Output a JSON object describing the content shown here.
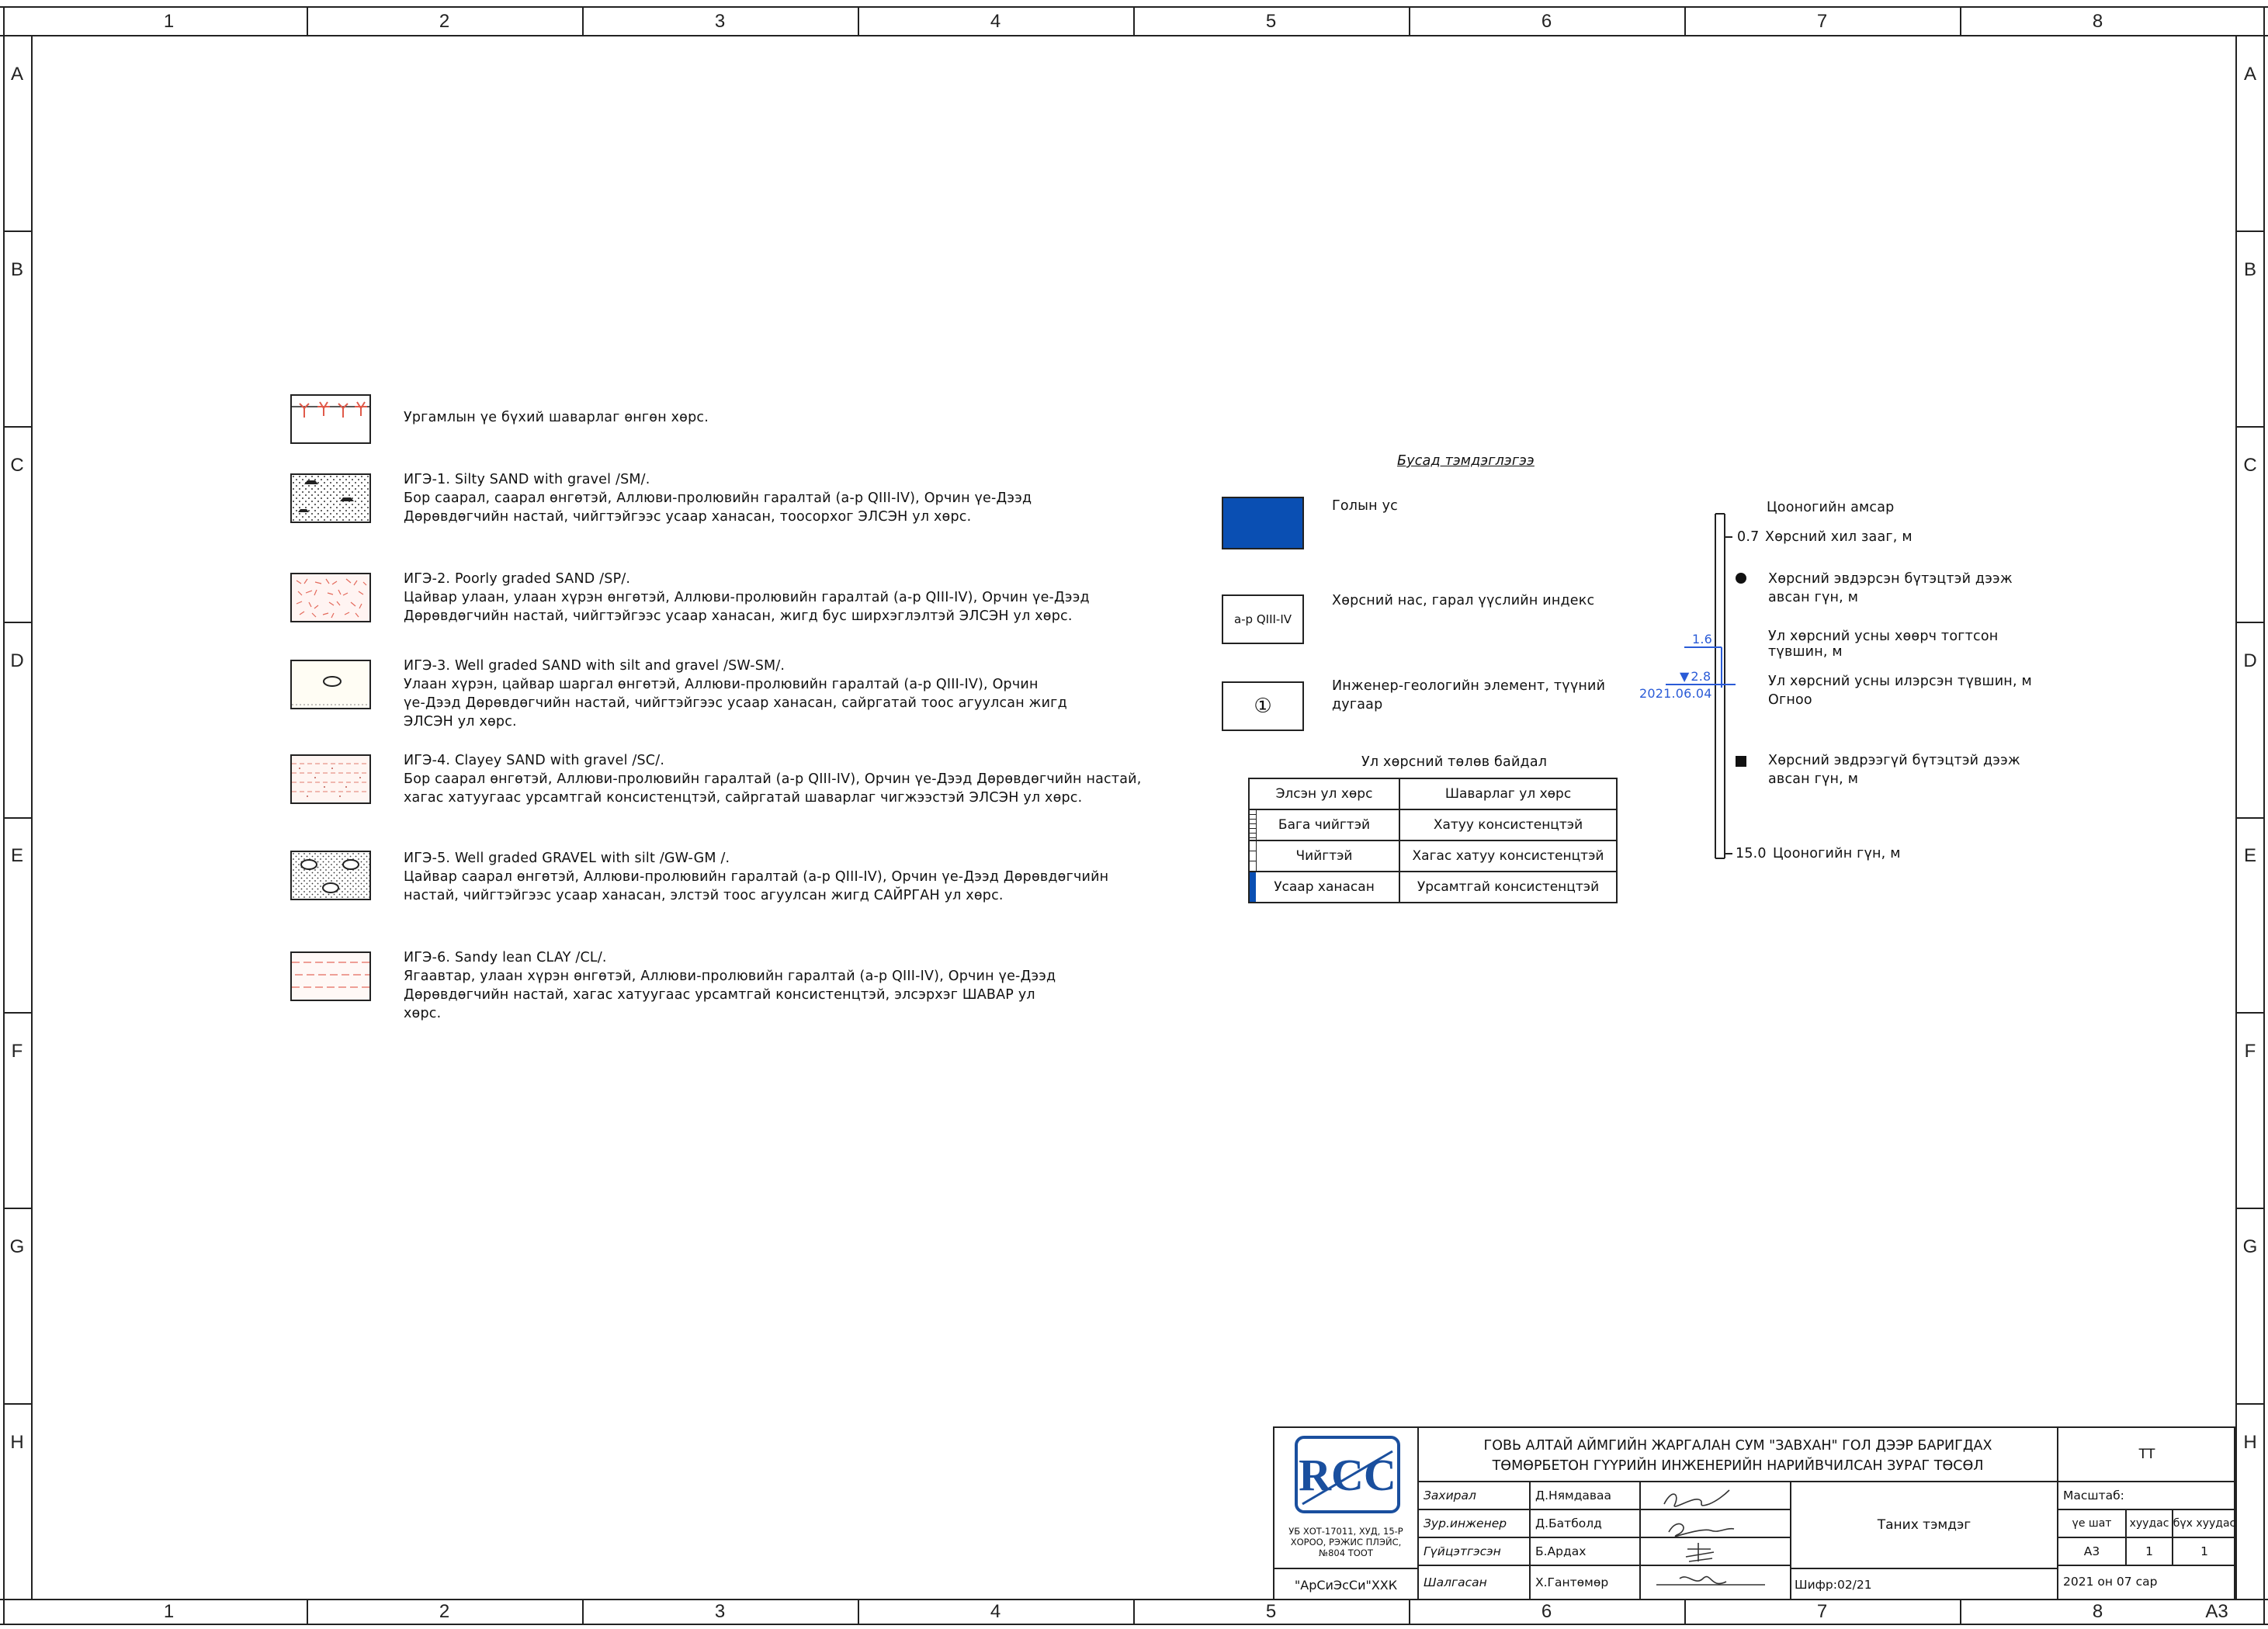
{
  "frame": {
    "col_labels": [
      "1",
      "2",
      "3",
      "4",
      "5",
      "6",
      "7",
      "8"
    ],
    "row_labels": [
      "A",
      "B",
      "C",
      "D",
      "E",
      "F",
      "G",
      "H"
    ],
    "sheet_size": "A3"
  },
  "legend": {
    "items": [
      {
        "id": "plant",
        "lines": [
          "Ургамлын үе бүхий шаварлаг өнгөн хөрс."
        ]
      },
      {
        "id": "ige1",
        "lines": [
          "ИГЭ-1. Silty SAND with gravel /SM/.",
          "Бор саарал, саарал өнгөтэй, Аллюви-пролювийн гаралтай (a-p QIII-IV), Орчин үе-Дээд",
          "Дөрөвдөгчийн настай, чийгтэйгээс усаар ханасан, тоосорхог ЭЛСЭН  ул  хөрс."
        ]
      },
      {
        "id": "ige2",
        "lines": [
          "ИГЭ-2. Poorly graded SAND  /SP/.",
          "Цайвар улаан, улаан хүрэн өнгөтэй, Аллюви-пролювийн гаралтай (a-p QIII-IV), Орчин үе-Дээд",
          "Дөрөвдөгчийн настай, чийгтэйгээс усаар ханасан, жигд бус ширхэглэлтэй ЭЛСЭН ул  хөрс."
        ]
      },
      {
        "id": "ige3",
        "lines": [
          "ИГЭ-3. Well graded SAND with silt and gravel  /SW-SM/.",
          "Улаан хүрэн, цайвар шаргал өнгөтэй, Аллюви-пролювийн гаралтай (a-p QIII-IV), Орчин",
          "үе-Дээд Дөрөвдөгчийн настай, чийгтэйгээс усаар ханасан, сайргатай тоос агуулсан жигд",
          "ЭЛСЭН ул  хөрс."
        ]
      },
      {
        "id": "ige4",
        "lines": [
          "ИГЭ-4. Clayey SAND with gravel /SC/.",
          "Бор саарал өнгөтэй, Аллюви-пролювийн гаралтай (a-p QIII-IV), Орчин үе-Дээд Дөрөвдөгчийн настай,",
          "хагас хатуугаас урсамтгай консистенцтэй, сайргатай шаварлаг чигжээстэй ЭЛСЭН ул  хөрс."
        ]
      },
      {
        "id": "ige5",
        "lines": [
          "ИГЭ-5. Well graded GRAVEL with silt /GW-GM /.",
          "Цайвар саарал өнгөтэй, Аллюви-пролювийн гаралтай (a-p QIII-IV), Орчин үе-Дээд Дөрөвдөгчийн",
          "настай, чийгтэйгээс усаар ханасан, элстэй тоос агуулсан жигд САЙРГАН ул  хөрс."
        ]
      },
      {
        "id": "ige6",
        "lines": [
          "ИГЭ-6. Sandy lean CLAY /CL/.",
          "Ягаавтар, улаан  хүрэн өнгөтэй, Аллюви-пролювийн гаралтай (a-p QIII-IV), Орчин үе-Дээд",
          "Дөрөвдөгчийн настай, хагас хатуугаас урсамтгай консистенцтэй, элсэрхэг ШАВАР ул",
          "хөрс."
        ]
      }
    ]
  },
  "other_symbols": {
    "title": "Бусад тэмдэглэгээ",
    "river": "Голын ус",
    "age_index_box": "a-p QIII-IV",
    "age_index": "Хөрсний нас, гарал үүслийн индекс",
    "element_number_box": "①",
    "element_number": [
      "Инженер-геологийн элемент, түүний",
      "дугаар"
    ],
    "soil_state_title": "Ул хөрсний төлөв байдал",
    "soil_state_table": {
      "headers": [
        "Элсэн ул хөрс",
        "Шаварлаг ул хөрс"
      ],
      "rows": [
        [
          "Бага чийгтэй",
          "Хатуу консистенцтэй"
        ],
        [
          "Чийгтэй",
          "Хагас хатуу консистенцтэй"
        ],
        [
          "Усаар ханасан",
          "Урсамтгай консистенцтэй"
        ]
      ]
    }
  },
  "borehole": {
    "collar": "Цооногийн амсар",
    "top_value": "0.7",
    "top_label": "Хөрсний хил зааг, м",
    "disturbed_sample": [
      "Хөрсний эвдэрсэн бүтэцтэй дээж",
      "авсан гүн, м"
    ],
    "water_stable_value": "1.6",
    "water_stable": [
      "Ул хөрсний усны хөөрч тогтсон",
      "түвшин, м"
    ],
    "water_found_value": "2.8",
    "water_date": "2021.06.04",
    "water_found": [
      "Ул хөрсний усны илэрсэн түвшин, м",
      "Огноо"
    ],
    "undisturbed_sample": [
      "Хөрсний эвдрээгүй бүтэцтэй дээж",
      "авсан гүн, м"
    ],
    "bottom_value": "15.0",
    "bottom_label": "Цооногийн гүн, м",
    "accent_color": "#2a5bd7"
  },
  "title_block": {
    "project_title": [
      "ГОВЬ АЛТАЙ АЙМГИЙН ЖАРГАЛАН СУМ \"ЗАВХАН\" ГОЛ ДЭЭР БАРИГДАХ",
      "ТӨМӨРБЕТОН ГҮҮРИЙН ИНЖЕНЕРИЙН НАРИЙВЧИЛСАН ЗУРАГ ТӨСӨЛ"
    ],
    "code": "ТТ",
    "logo_text": "RCC",
    "company_address": [
      "УБ ХОТ-17011, ХУД, 15-Р",
      "ХОРОО, РЭЖИС ПЛЭЙС,",
      "№804 ТООТ"
    ],
    "company_name": "\"АрСиЭсСи\"ХХК",
    "roles": [
      {
        "role": "Захирал",
        "name": "Д.Нямдаваа"
      },
      {
        "role": "Зур.инженер",
        "name": "Д.Батболд"
      },
      {
        "role": "Гүйцэтгэсэн",
        "name": "Б.Ардах"
      },
      {
        "role": "Шалгасан",
        "name": "Х.Гантөмөр"
      }
    ],
    "sheet_title": "Таних тэмдэг",
    "cipher": "Шифр:02/21",
    "scale_label": "Масштаб:",
    "stage_label": "үе шат",
    "sheet_label": "хуудас",
    "total_label": "бүх хуудас",
    "stage": "A3",
    "sheet": "1",
    "total": "1",
    "date": "2021 он 07 сар"
  }
}
